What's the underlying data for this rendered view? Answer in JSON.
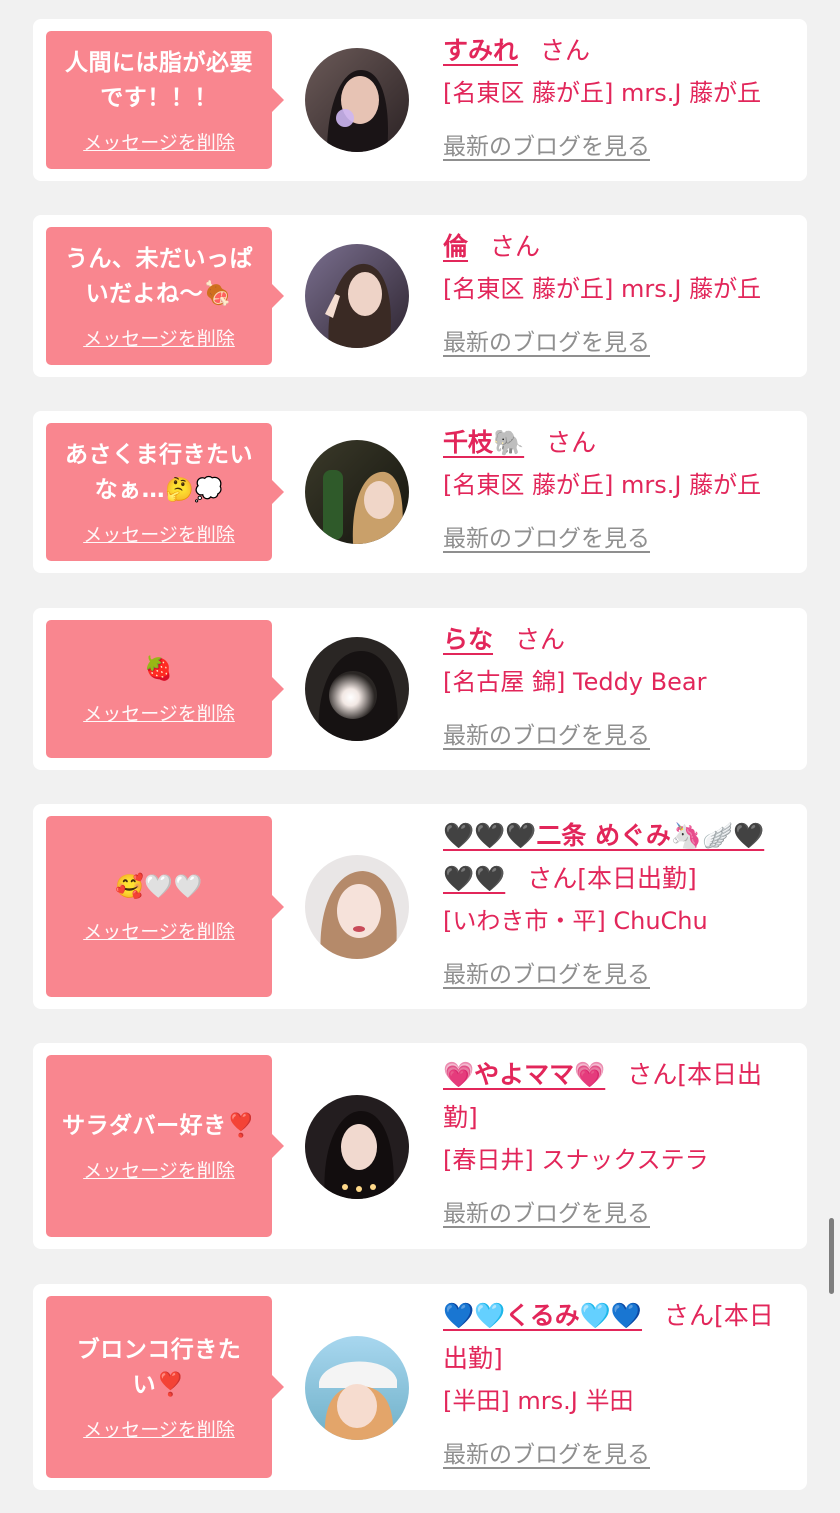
{
  "delete_label": "メッセージを削除",
  "blog_label": "最新のブログを見る",
  "san": "さん",
  "colors": {
    "accent": "#e2265a",
    "bubble": "#f9868f",
    "background": "#f1f1f1"
  },
  "messages": [
    {
      "bubble_line1": "人間には脂が必要",
      "bubble_line2": "です！！！",
      "name": "すみれ",
      "after_san": "",
      "shop": "[名東区 藤が丘] mrs.J 藤が丘"
    },
    {
      "bubble_line1": "うん、未だいっぱ",
      "bubble_line2": "いだよね〜🍖",
      "name": "倫",
      "after_san": "",
      "shop": "[名東区 藤が丘] mrs.J 藤が丘"
    },
    {
      "bubble_line1": "あさくま行きたい",
      "bubble_line2": "なぁ…🤔💭",
      "name": "千枝🐘",
      "after_san": "",
      "shop": "[名東区 藤が丘] mrs.J 藤が丘"
    },
    {
      "bubble_line1": "🍓",
      "bubble_line2": "",
      "name": "らな",
      "after_san": "",
      "shop": "[名古屋 錦] Teddy Bear"
    },
    {
      "bubble_line1": "🥰🤍🤍",
      "bubble_line2": "",
      "name": "🖤🖤🖤二条 めぐみ🦄🪽🖤🖤🖤",
      "after_san": "[本日出勤]",
      "shop": "[いわき市・平] ChuChu"
    },
    {
      "bubble_line1": "サラダバー好き❣️",
      "bubble_line2": "",
      "name": "💗やよママ💗",
      "after_san": "[本日出勤]",
      "shop": "[春日井] スナックステラ"
    },
    {
      "bubble_line1": "ブロンコ行きた",
      "bubble_line2": "い❣️",
      "name": "💙🩵くるみ🩵💙",
      "after_san": "[本日出勤]",
      "shop": "[半田] mrs.J 半田"
    }
  ]
}
